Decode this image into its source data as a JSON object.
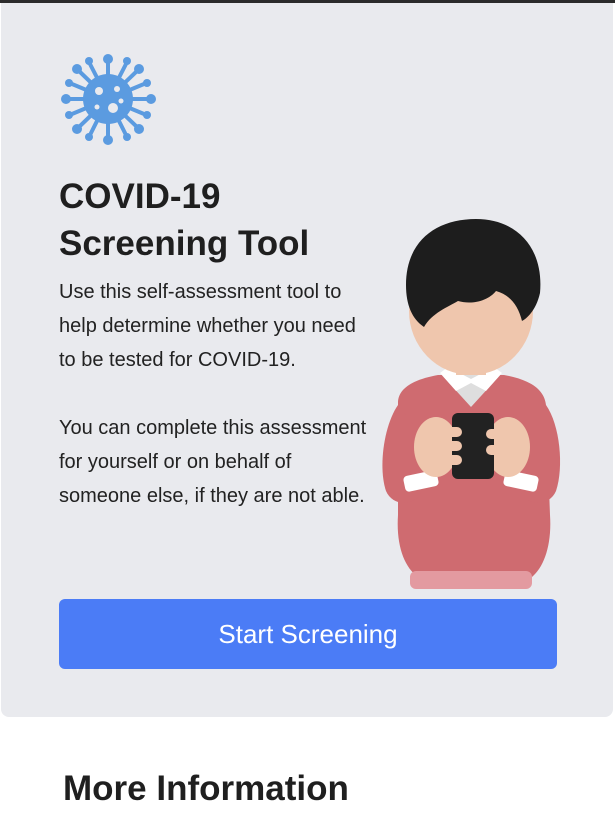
{
  "hero": {
    "icon": "virus-icon",
    "title_line1": "COVID-19",
    "title_line2": "Screening Tool",
    "description_1": "Use this self-assessment tool to help determine whether you need to be tested for COVID-19.",
    "description_2": "You can complete this assessment for yourself or on behalf of someone else, if they are not able.",
    "illustration": "person-holding-phone",
    "start_button_label": "Start Screening"
  },
  "more_info": {
    "title": "More Information"
  },
  "colors": {
    "card_background": "#e9eaee",
    "button_background": "#4b7cf6",
    "virus_blue": "#5b9be0",
    "sweater": "#cf6b70"
  }
}
